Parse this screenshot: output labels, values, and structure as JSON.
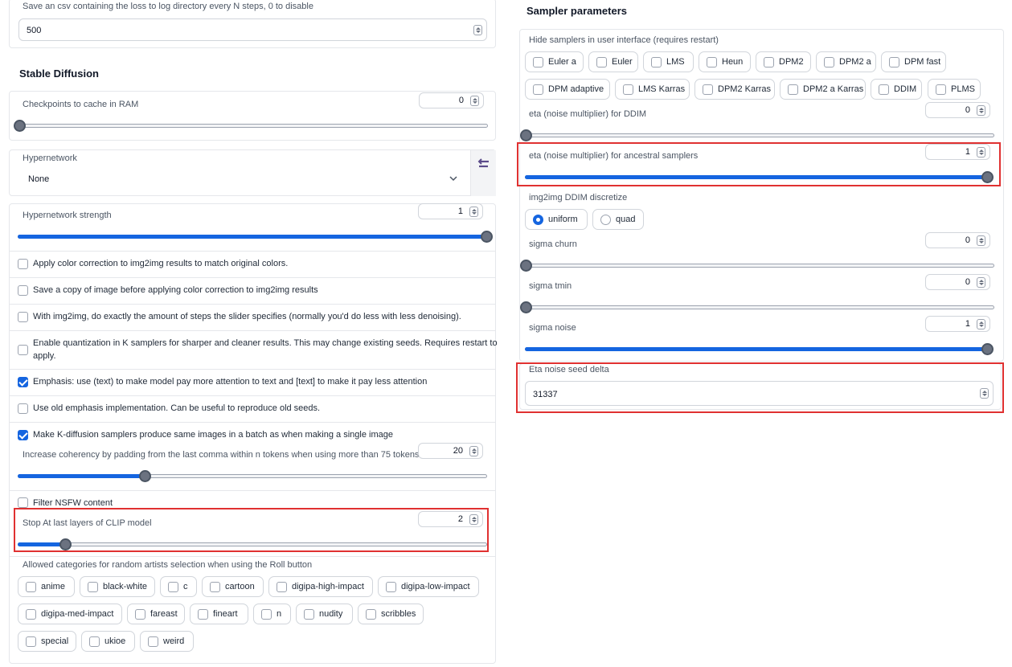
{
  "left": {
    "csv": {
      "label": "Save an csv containing the loss to log directory every N steps, 0 to disable",
      "value": "500"
    },
    "section_title": "Stable Diffusion",
    "checkpoints": {
      "label": "Checkpoints to cache in RAM",
      "value": "0",
      "fraction": 0
    },
    "hypernetwork": {
      "label": "Hypernetwork",
      "value": "None"
    },
    "hyper_strength": {
      "label": "Hypernetwork strength",
      "value": "1",
      "fraction": 1
    },
    "checkboxes": [
      {
        "label": "Apply color correction to img2img results to match original colors.",
        "checked": false
      },
      {
        "label": "Save a copy of image before applying color correction to img2img results",
        "checked": false
      },
      {
        "label": "With img2img, do exactly the amount of steps the slider specifies (normally you'd do less with less denoising).",
        "checked": false
      },
      {
        "label": "Enable quantization in K samplers for sharper and cleaner results. This may change existing seeds. Requires restart to",
        "label2": "apply.",
        "checked": false
      },
      {
        "label": "Emphasis: use (text) to make model pay more attention to text and [text] to make it pay less attention",
        "checked": true
      },
      {
        "label": "Use old emphasis implementation. Can be useful to reproduce old seeds.",
        "checked": false
      },
      {
        "label": "Make K-diffusion samplers produce same images in a batch as when making a single image",
        "checked": true
      }
    ],
    "coherency": {
      "label": "Increase coherency by padding from the last comma within n tokens when using more than 75 tokens",
      "value": "20",
      "fraction": 0.27
    },
    "nsfw": {
      "label": "Filter NSFW content",
      "checked": false
    },
    "clip": {
      "label": "Stop At last layers of CLIP model",
      "value": "2",
      "fraction": 0.1
    },
    "artists": {
      "label": "Allowed categories for random artists selection when using the Roll button",
      "row1": [
        "anime",
        "black-white",
        "c",
        "cartoon",
        "digipa-high-impact",
        "digipa-low-impact"
      ],
      "row2": [
        "digipa-med-impact",
        "fareast",
        "fineart",
        "n",
        "nudity",
        "scribbles"
      ],
      "row3": [
        "special",
        "ukioe",
        "weird"
      ]
    }
  },
  "right": {
    "section_title": "Sampler parameters",
    "hide_label": "Hide samplers in user interface (requires restart)",
    "samplers_row1": [
      "Euler a",
      "Euler",
      "LMS",
      "Heun",
      "DPM2",
      "DPM2 a",
      "DPM fast"
    ],
    "samplers_row2": [
      "DPM adaptive",
      "LMS Karras",
      "DPM2 Karras",
      "DPM2 a Karras",
      "DDIM",
      "PLMS"
    ],
    "eta_ddim": {
      "label": "eta (noise multiplier) for DDIM",
      "value": "0",
      "fraction": 0
    },
    "eta_ancestral": {
      "label": "eta (noise multiplier) for ancestral samplers",
      "value": "1",
      "fraction": 1
    },
    "discretize": {
      "label": "img2img DDIM discretize",
      "options": [
        "uniform",
        "quad"
      ],
      "selected": "uniform"
    },
    "sigma_churn": {
      "label": "sigma churn",
      "value": "0",
      "fraction": 0
    },
    "sigma_tmin": {
      "label": "sigma tmin",
      "value": "0",
      "fraction": 0
    },
    "sigma_noise": {
      "label": "sigma noise",
      "value": "1",
      "fraction": 1
    },
    "seed_delta": {
      "label": "Eta noise seed delta",
      "value": "31337"
    }
  },
  "colors": {
    "accent": "#1565e0",
    "highlight": "#e03131",
    "hypernet_icon": "#5b4b8a"
  }
}
